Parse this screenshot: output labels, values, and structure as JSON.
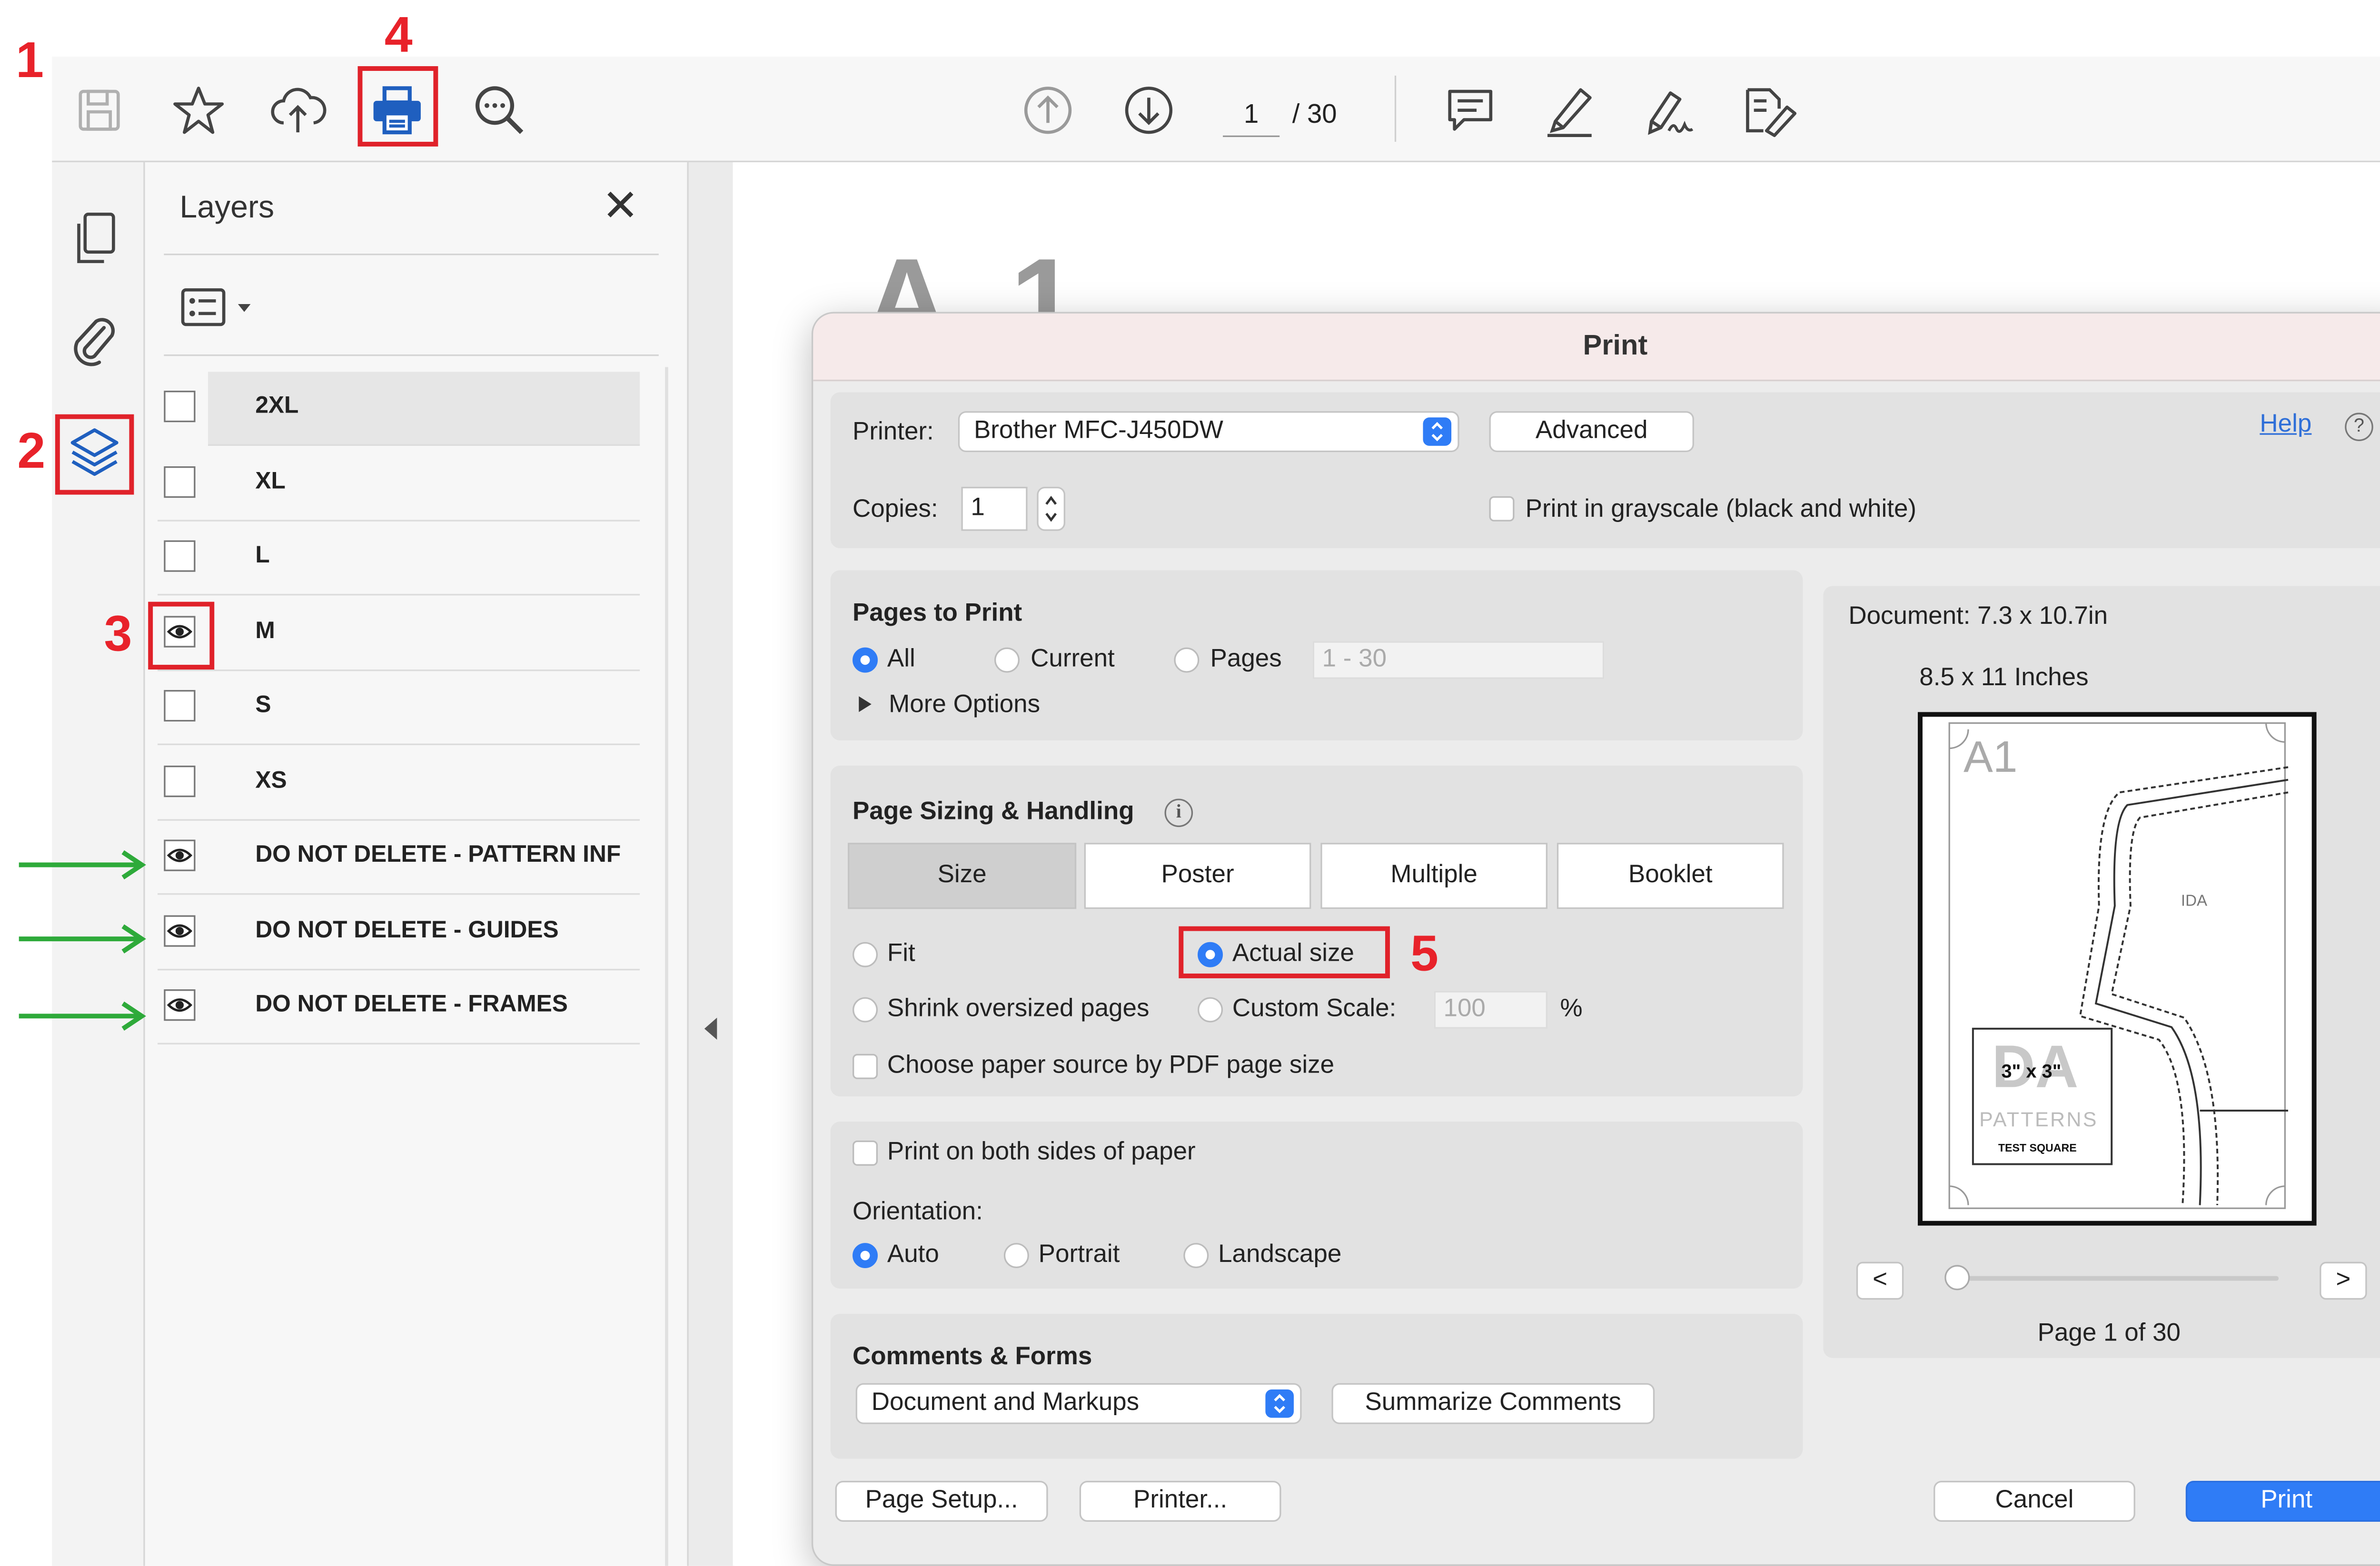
{
  "annotations": {
    "step1": "1",
    "step2": "2",
    "step3": "3",
    "step4": "4",
    "step5": "5"
  },
  "toolbar": {
    "icons": [
      "save-icon",
      "star-icon",
      "cloud-upload-icon",
      "print-icon",
      "zoom-search-icon",
      "page-up-icon",
      "page-down-icon",
      "comment-icon",
      "highlight-pen-icon",
      "sign-icon",
      "redact-icon"
    ],
    "current_page": "1",
    "total_pages": "/ 30"
  },
  "rail": {
    "icons": [
      "pages-icon",
      "attachment-icon",
      "layers-icon"
    ]
  },
  "layers": {
    "title": "Layers",
    "close": "✕",
    "options_icon": "list-options-icon",
    "items": [
      {
        "name": "2XL",
        "visible": false,
        "selected": true
      },
      {
        "name": "XL",
        "visible": false
      },
      {
        "name": "L",
        "visible": false
      },
      {
        "name": "M",
        "visible": true
      },
      {
        "name": "S",
        "visible": false
      },
      {
        "name": "XS",
        "visible": false
      },
      {
        "name": "DO NOT DELETE - PATTERN INF",
        "visible": true
      },
      {
        "name": "DO NOT DELETE - GUIDES",
        "visible": true
      },
      {
        "name": "DO NOT DELETE - FRAMES",
        "visible": true
      }
    ]
  },
  "document": {
    "page_heading": "A 1"
  },
  "dialog": {
    "title": "Print",
    "printer_label": "Printer:",
    "printer_value": "Brother MFC-J450DW",
    "advanced": "Advanced",
    "help": "Help",
    "help_q": "?",
    "copies_label": "Copies:",
    "copies_value": "1",
    "grayscale": "Print in grayscale (black and white)",
    "pages_to_print": {
      "title": "Pages to Print",
      "all": "All",
      "current": "Current",
      "pages": "Pages",
      "pages_range": "1 - 30",
      "more_options": "More Options",
      "selected": "All"
    },
    "sizing": {
      "title": "Page Sizing & Handling",
      "info": "i",
      "tabs": [
        "Size",
        "Poster",
        "Multiple",
        "Booklet"
      ],
      "active_tab": "Size",
      "fit": "Fit",
      "actual_size": "Actual size",
      "shrink": "Shrink oversized pages",
      "custom_scale": "Custom Scale:",
      "custom_scale_value": "100",
      "percent": "%",
      "paper_source": "Choose paper source by PDF page size",
      "selected": "Actual size"
    },
    "both_sides": "Print on both sides of paper",
    "orientation": {
      "label": "Orientation:",
      "auto": "Auto",
      "portrait": "Portrait",
      "landscape": "Landscape",
      "selected": "Auto"
    },
    "comments": {
      "title": "Comments & Forms",
      "value": "Document and Markups",
      "summarize": "Summarize Comments"
    },
    "preview": {
      "document_size": "Document: 7.3 x 10.7in",
      "paper_size": "8.5 x 11 Inches",
      "page_label": "A1",
      "test_square": "3\" x 3\"",
      "logo_text": "DA",
      "patterns": "PATTERNS",
      "test_label": "TEST SQUARE",
      "inner_mark": "IDA",
      "prev": "<",
      "next": ">",
      "page_indicator": "Page 1 of 30"
    },
    "page_setup": "Page Setup...",
    "printer_btn": "Printer...",
    "cancel": "Cancel",
    "print": "Print"
  },
  "colors": {
    "annotation_red": "#e0222a",
    "arrow_green": "#2eaa3a",
    "accent_blue": "#2f7cf6",
    "print_icon_blue": "#1f5fbf"
  }
}
